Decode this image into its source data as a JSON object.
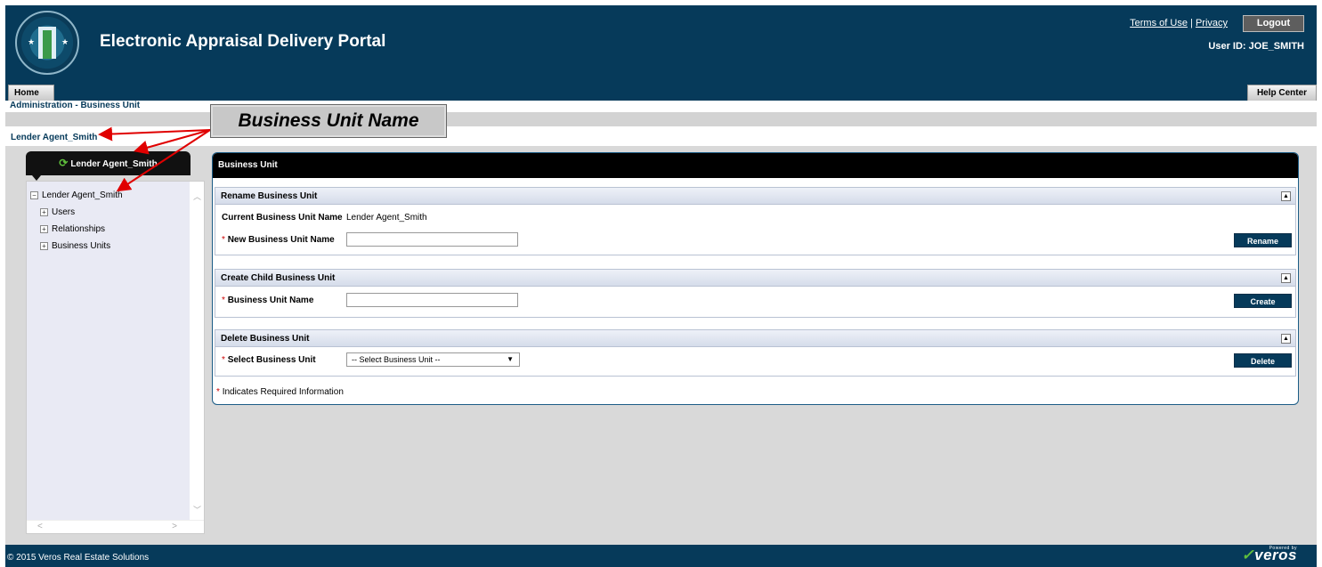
{
  "header": {
    "title": "Electronic Appraisal Delivery Portal",
    "terms_label": "Terms of Use",
    "separator": "|",
    "privacy_label": "Privacy",
    "logout_label": "Logout",
    "user_id": "User ID: JOE_SMITH"
  },
  "nav": {
    "home_tab": "Home",
    "help_tab": "Help Center"
  },
  "breadcrumb": "Administration - Business Unit",
  "business_unit_label": "Lender Agent_Smith",
  "callout": "Business Unit Name",
  "tree": {
    "header": "Lender Agent_Smith",
    "root": "Lender Agent_Smith",
    "children": [
      "Users",
      "Relationships",
      "Business Units"
    ]
  },
  "main": {
    "title": "Business Unit",
    "rename": {
      "heading": "Rename Business Unit",
      "current_label": "Current Business Unit Name",
      "current_value": "Lender Agent_Smith",
      "new_label": "New Business Unit Name",
      "new_value": "",
      "button": "Rename"
    },
    "create": {
      "heading": "Create Child Business Unit",
      "name_label": "Business Unit Name",
      "name_value": "",
      "button": "Create"
    },
    "delete": {
      "heading": "Delete Business Unit",
      "select_label": "Select Business Unit",
      "select_value": "-- Select Business Unit --",
      "button": "Delete"
    },
    "required_asterisk": "*",
    "required_note": "Indicates Required Information"
  },
  "footer": {
    "copyright": "© 2015 Veros Real Estate Solutions",
    "logo_text": "veros",
    "logo_tag": "Powered by"
  },
  "colors": {
    "brand_navy": "#063a5a",
    "accent_green": "#5fbf3c",
    "required_red": "#cc0000",
    "arrow_red": "#e00000"
  }
}
